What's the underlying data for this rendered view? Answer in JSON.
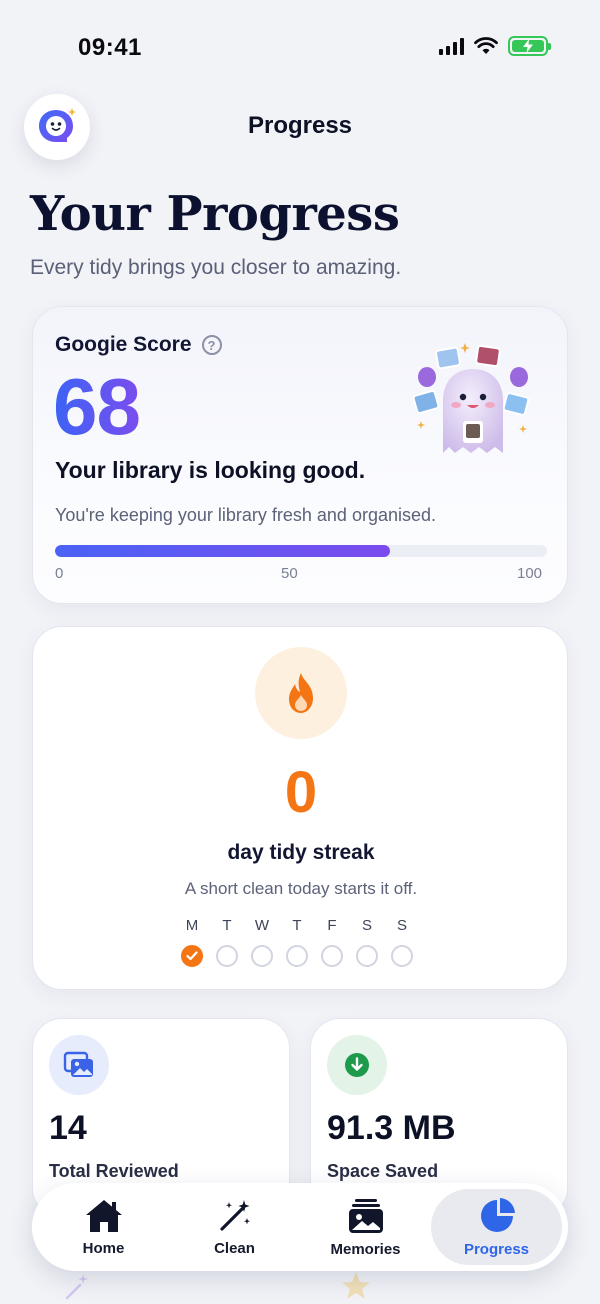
{
  "status_bar": {
    "time": "09:41"
  },
  "header": {
    "title": "Progress"
  },
  "page": {
    "title": "Your Progress",
    "subtitle": "Every tidy brings you closer to amazing."
  },
  "score": {
    "label": "Googie Score",
    "value": "68",
    "progress_fraction": 0.68,
    "headline": "Your library is looking good.",
    "description": "You're keeping your library fresh and organised.",
    "ticks": [
      "0",
      "50",
      "100"
    ],
    "bar_gradient": [
      "#4a62f5",
      "#7b4ced"
    ]
  },
  "streak": {
    "value": "0",
    "label": "day tidy streak",
    "hint": "A short clean today starts it off.",
    "days": [
      {
        "letter": "M",
        "done": true
      },
      {
        "letter": "T",
        "done": false
      },
      {
        "letter": "W",
        "done": false
      },
      {
        "letter": "T",
        "done": false
      },
      {
        "letter": "F",
        "done": false
      },
      {
        "letter": "S",
        "done": false
      },
      {
        "letter": "S",
        "done": false
      }
    ],
    "accent": "#f47514"
  },
  "stats": [
    {
      "value": "14",
      "label": "Total Reviewed",
      "icon": "photos-icon",
      "accent": "#3a63e8"
    },
    {
      "value": "91.3 MB",
      "label": "Space Saved",
      "icon": "download-arrow-icon",
      "accent": "#1e9a4b"
    }
  ],
  "tabs": [
    {
      "label": "Home",
      "icon": "home-icon",
      "active": false
    },
    {
      "label": "Clean",
      "icon": "magic-wand-icon",
      "active": false
    },
    {
      "label": "Memories",
      "icon": "photo-stack-icon",
      "active": false
    },
    {
      "label": "Progress",
      "icon": "pie-chart-icon",
      "active": true
    }
  ],
  "colors": {
    "primary": "#2f66e8",
    "background": "#f2f3f7"
  }
}
